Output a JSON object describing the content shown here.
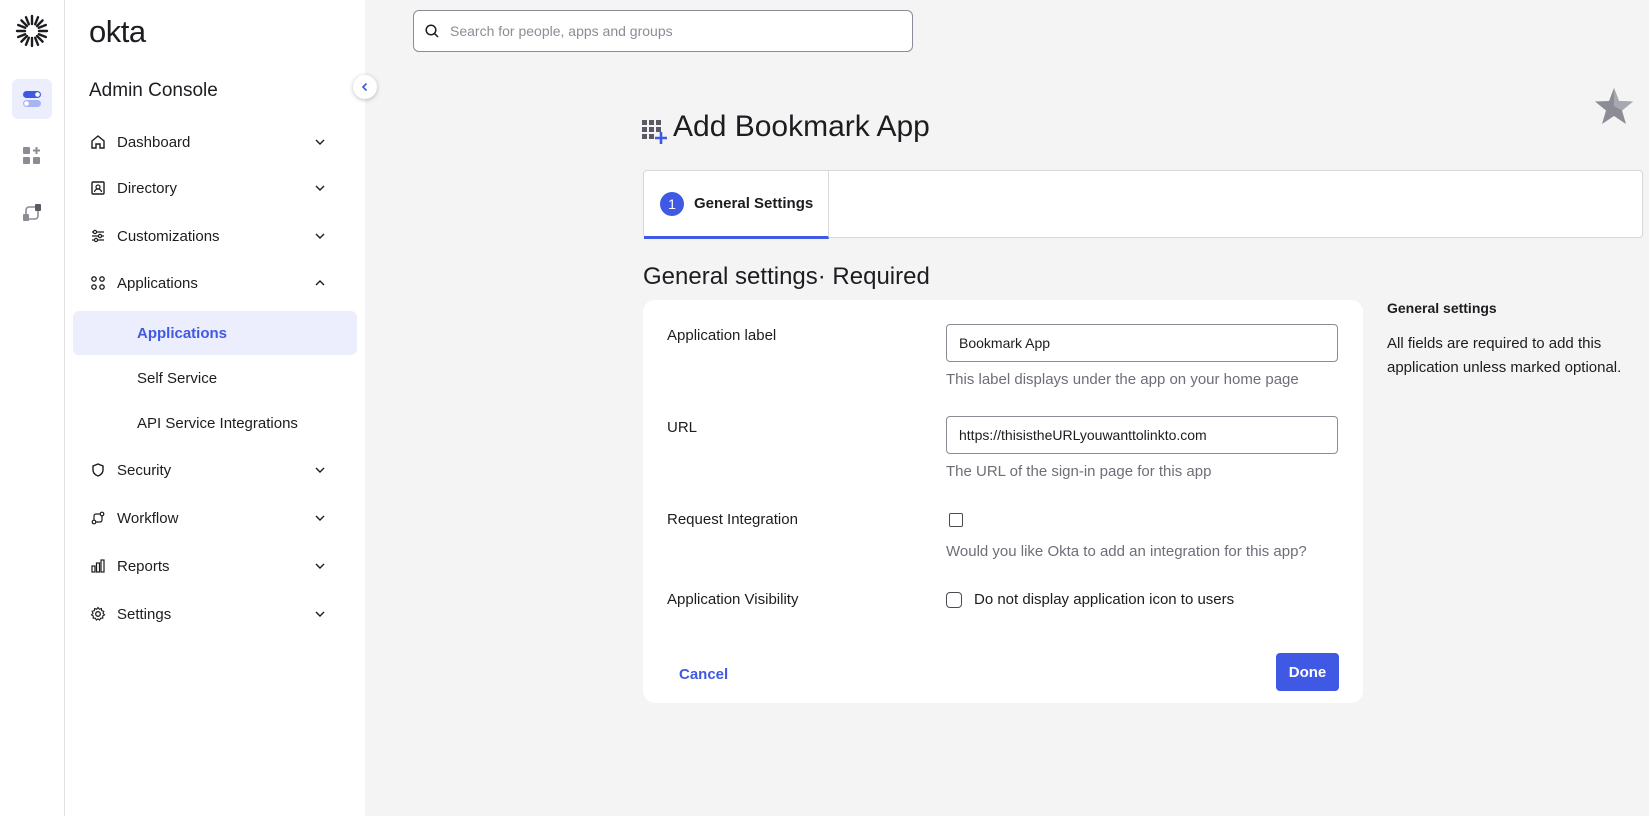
{
  "rail": {
    "items": [
      {
        "icon": "toggle-icon",
        "active": true
      },
      {
        "icon": "add-apps-icon",
        "active": false
      },
      {
        "icon": "workflow-icon",
        "active": false
      }
    ]
  },
  "sidebar": {
    "brand": "okta",
    "console_title": "Admin Console",
    "nav": [
      {
        "label": "Dashboard",
        "icon": "home-icon"
      },
      {
        "label": "Directory",
        "icon": "directory-icon"
      },
      {
        "label": "Customizations",
        "icon": "sliders-icon"
      },
      {
        "label": "Applications",
        "icon": "apps-grid-icon",
        "expanded": true,
        "children": [
          {
            "label": "Applications",
            "active": true
          },
          {
            "label": "Self Service"
          },
          {
            "label": "API Service Integrations"
          }
        ]
      },
      {
        "label": "Security",
        "icon": "shield-icon"
      },
      {
        "label": "Workflow",
        "icon": "workflow-icon"
      },
      {
        "label": "Reports",
        "icon": "bar-chart-icon"
      },
      {
        "label": "Settings",
        "icon": "gear-icon"
      }
    ]
  },
  "search": {
    "placeholder": "Search for people, apps and groups",
    "value": ""
  },
  "page": {
    "title": "Add Bookmark App",
    "step": {
      "number": "1",
      "label": "General Settings"
    },
    "section_title": "General settings· Required"
  },
  "form": {
    "app_label": {
      "label": "Application label",
      "value": "Bookmark App",
      "help": "This label displays under the app on your home page"
    },
    "url": {
      "label": "URL",
      "value": "https://thisistheURLyouwanttolinkto.com",
      "help": "The URL of the sign-in page for this app"
    },
    "request_integration": {
      "label": "Request Integration",
      "checked": false,
      "help": "Would you like Okta to add an integration for this app?"
    },
    "visibility": {
      "label": "Application Visibility",
      "checked": false,
      "option": "Do not display application icon to users"
    },
    "cancel_label": "Cancel",
    "done_label": "Done"
  },
  "aside": {
    "title": "General settings",
    "text": "All fields are required to add this application unless marked optional."
  },
  "colors": {
    "accent": "#3f59e4",
    "accent_bg": "#eceefd",
    "page_bg": "#f4f4f4"
  }
}
